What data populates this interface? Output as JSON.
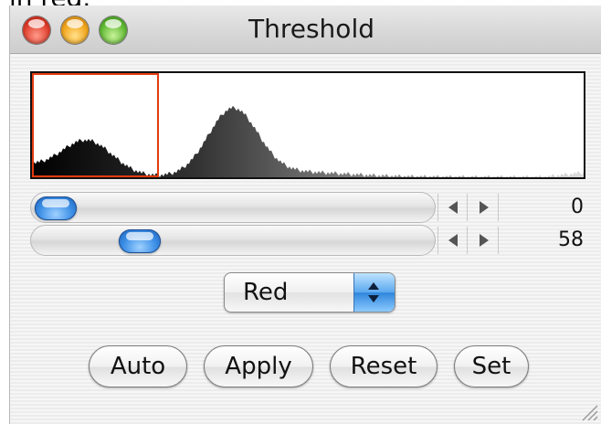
{
  "background_text": "in red.",
  "window": {
    "title": "Threshold"
  },
  "histogram": {
    "selection_color": "#e23b10"
  },
  "sliders": [
    {
      "value_label": "0",
      "position_fraction": 0.0
    },
    {
      "value_label": "58",
      "position_fraction": 0.23
    }
  ],
  "color_popup": {
    "selected": "Red"
  },
  "buttons": {
    "auto": "Auto",
    "apply": "Apply",
    "reset": "Reset",
    "set": "Set"
  },
  "icons": [
    "close-icon",
    "minimize-icon",
    "zoom-icon",
    "arrow-left-icon",
    "arrow-right-icon",
    "popup-arrows-icon",
    "resize-grip-icon"
  ]
}
